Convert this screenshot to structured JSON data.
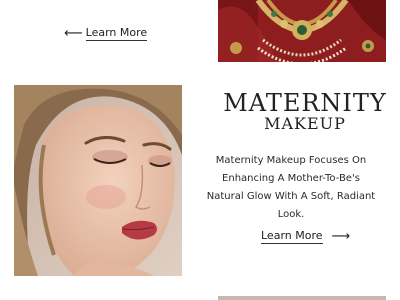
{
  "top_link": {
    "arrow": "⟵",
    "label": "Learn More"
  },
  "section": {
    "title": "MATERNITY",
    "subtitle": "MAKEUP",
    "description": "Maternity Makeup Focuses On Enhancing A Mother-To-Be's Natural Glow With A Soft, Radiant Look."
  },
  "bottom_link": {
    "label": "Learn More",
    "arrow": "⟶"
  },
  "colors": {
    "background": "#ffffff",
    "text": "#1e1e1e",
    "jewelry_red": "#8a1c1c",
    "skin_tone": "#d8b8a3"
  }
}
